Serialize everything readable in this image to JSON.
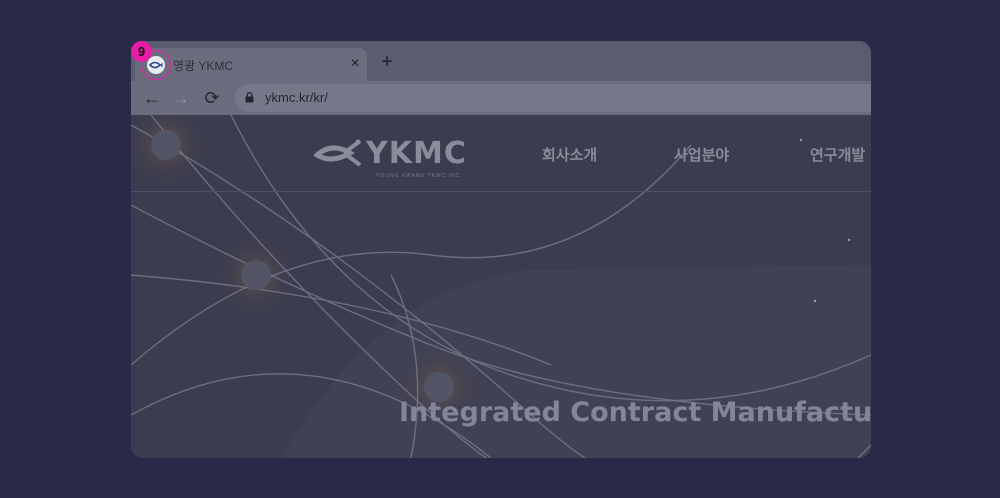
{
  "browser": {
    "tab": {
      "title": "영광 YKMC",
      "favicon": "ykmc-fish-icon",
      "close_label": "×"
    },
    "new_tab_label": "+",
    "toolbar": {
      "back_label": "←",
      "forward_label": "→",
      "reload_label": "⟳",
      "url": "ykmc.kr/kr/"
    }
  },
  "annotation": {
    "badge_number": "9",
    "color": "#e81ca6"
  },
  "site": {
    "logo_text": "YKMC",
    "logo_sub": "YOUNG KWANG YKMC INC.",
    "menu": [
      {
        "label": "회사소개"
      },
      {
        "label": "사업분야"
      },
      {
        "label": "연구개발"
      }
    ],
    "hero_text": "Integrated Contract Manufacturer"
  },
  "colors": {
    "backdrop": "#292a48",
    "page_bg": "#3b3c4f",
    "text_muted": "#8a8c99"
  }
}
